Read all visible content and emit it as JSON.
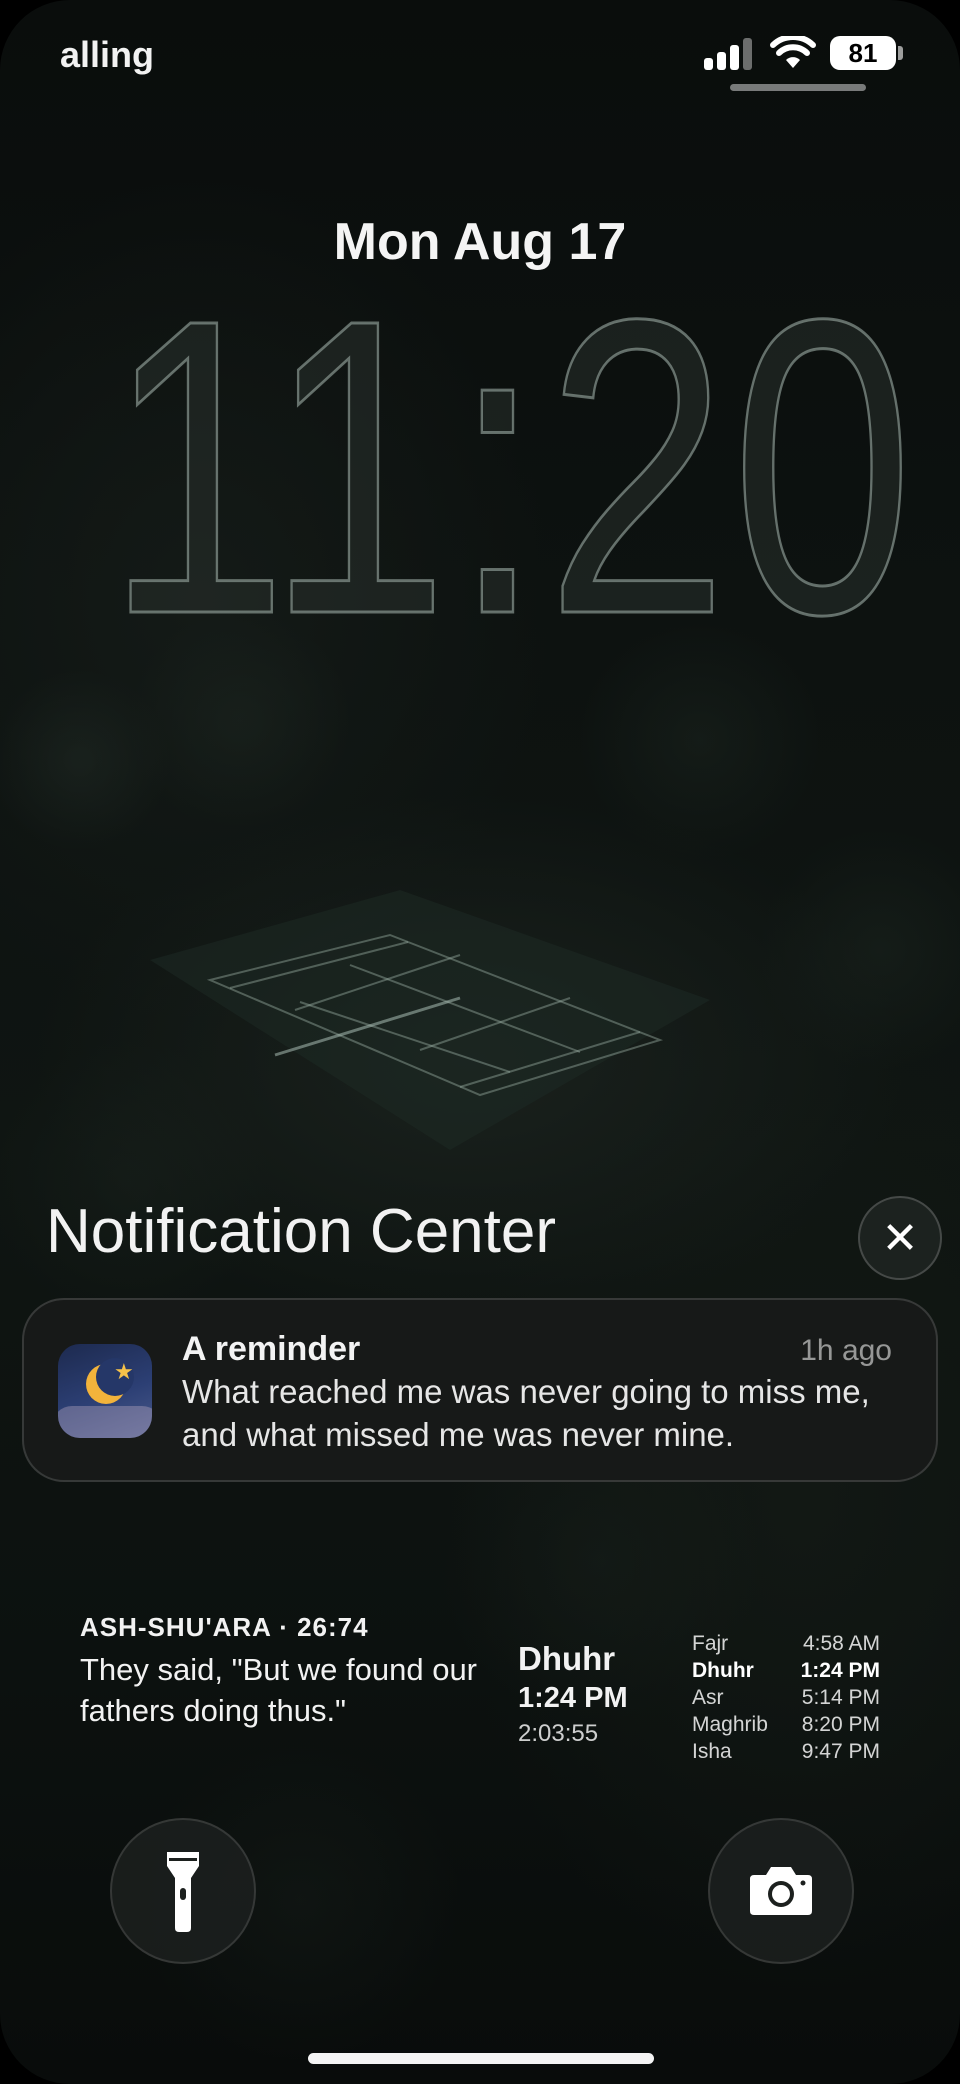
{
  "status_bar": {
    "carrier": "alling",
    "battery": "81"
  },
  "lock": {
    "date": "Mon Aug 17",
    "time": "11:20"
  },
  "notification_center": {
    "title": "Notification Center",
    "close_label": "✕",
    "notifications": [
      {
        "icon": "crescent-moon-app-icon",
        "title": "A reminder",
        "time": "1h ago",
        "body": "What reached me was never going to miss me, and what missed me was never mine."
      }
    ]
  },
  "widgets": {
    "verse": {
      "reference": "ASH-SHU'ARA · 26:74",
      "text": "They said, \"But we found our fathers doing thus.\""
    },
    "prayer": {
      "current_name": "Dhuhr",
      "current_time": "1:24 PM",
      "countdown": "2:03:55",
      "times": [
        {
          "name": "Fajr",
          "time": "4:58 AM"
        },
        {
          "name": "Dhuhr",
          "time": "1:24 PM"
        },
        {
          "name": "Asr",
          "time": "5:14 PM"
        },
        {
          "name": "Maghrib",
          "time": "8:20 PM"
        },
        {
          "name": "Isha",
          "time": "9:47 PM"
        }
      ],
      "active_index": 1
    }
  },
  "quick_actions": {
    "left": "flashlight-icon",
    "right": "camera-icon"
  }
}
